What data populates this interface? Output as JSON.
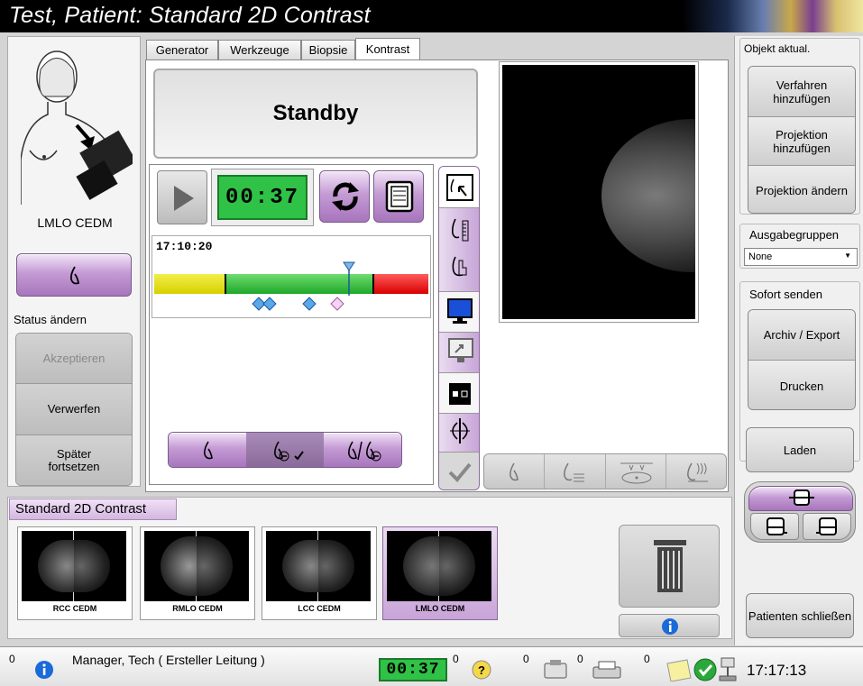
{
  "title": "Test, Patient:  Standard 2D Contrast",
  "left": {
    "view_label": "LMLO CEDM",
    "status_label": "Status ändern",
    "accept": "Akzeptieren",
    "reject": "Verwerfen",
    "later": "Später fortsetzen"
  },
  "tabs": [
    "Generator",
    "Werkzeuge",
    "Biopsie",
    "Kontrast"
  ],
  "contrast": {
    "state": "Standby",
    "timer": "00:37",
    "injection_time": "17:10:20",
    "progress_marker": 0.71
  },
  "right": {
    "update_group": "Objekt aktual.",
    "add_procedure": "Verfahren hinzufügen",
    "add_view": "Projektion hinzufügen",
    "edit_view": "Projektion ändern",
    "output_groups": "Ausgabegruppen",
    "output_value": "None",
    "send_now": "Sofort senden",
    "archive": "Archiv / Export",
    "print": "Drucken",
    "load": "Laden",
    "close_patient": "Patienten schließen"
  },
  "procedure": {
    "name": "Standard 2D Contrast",
    "thumbnails": [
      "RCC CEDM",
      "RMLO CEDM",
      "LCC CEDM",
      "LMLO CEDM"
    ]
  },
  "status": {
    "counter1": "0",
    "user": "Manager, Tech ( Ersteller Leitung )",
    "timer": "00:37",
    "counter2": "0",
    "counter3": "0",
    "counter4": "0",
    "counter5": "0",
    "clock": "17:17:13"
  }
}
